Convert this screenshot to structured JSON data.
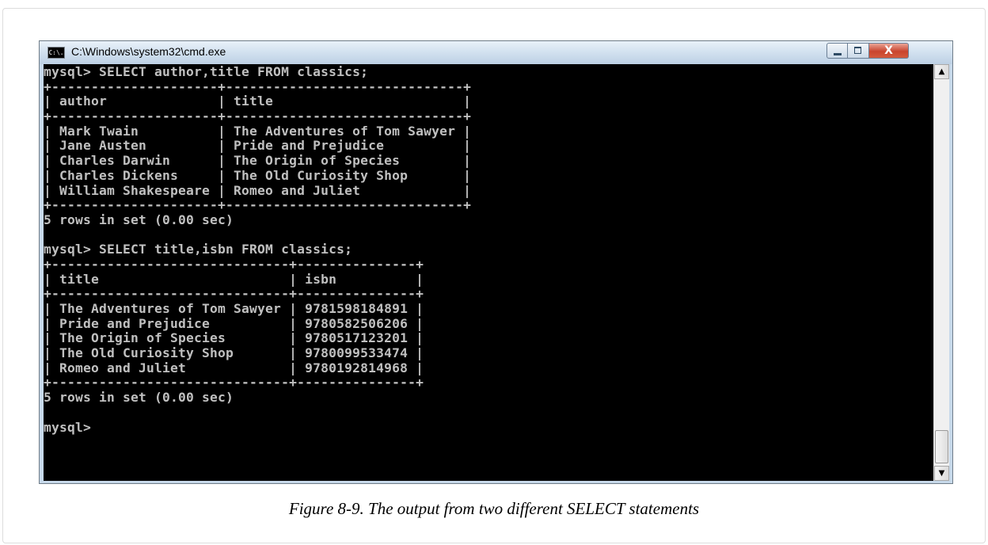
{
  "window": {
    "title": "C:\\Windows\\system32\\cmd.exe",
    "icon_label": "C:\\.",
    "controls": {
      "minimize": "minimize",
      "maximize": "maximize",
      "close": "X"
    }
  },
  "console": {
    "lines": [
      "mysql> SELECT author,title FROM classics;",
      "+---------------------+------------------------------+",
      "| author              | title                        |",
      "+---------------------+------------------------------+",
      "| Mark Twain          | The Adventures of Tom Sawyer |",
      "| Jane Austen         | Pride and Prejudice          |",
      "| Charles Darwin      | The Origin of Species        |",
      "| Charles Dickens     | The Old Curiosity Shop       |",
      "| William Shakespeare | Romeo and Juliet             |",
      "+---------------------+------------------------------+",
      "5 rows in set (0.00 sec)",
      "",
      "mysql> SELECT title,isbn FROM classics;",
      "+------------------------------+---------------+",
      "| title                        | isbn          |",
      "+------------------------------+---------------+",
      "| The Adventures of Tom Sawyer | 9781598184891 |",
      "| Pride and Prejudice          | 9780582506206 |",
      "| The Origin of Species        | 9780517123201 |",
      "| The Old Curiosity Shop       | 9780099533474 |",
      "| Romeo and Juliet             | 9780192814968 |",
      "+------------------------------+---------------+",
      "5 rows in set (0.00 sec)",
      "",
      "mysql>"
    ]
  },
  "scrollbar": {
    "up_arrow": "▲",
    "down_arrow": "▼"
  },
  "caption": "Figure 8-9. The output from two different SELECT statements",
  "colors": {
    "console_bg": "#000000",
    "console_text": "#c0c0c0",
    "close_button": "#c9452e"
  }
}
